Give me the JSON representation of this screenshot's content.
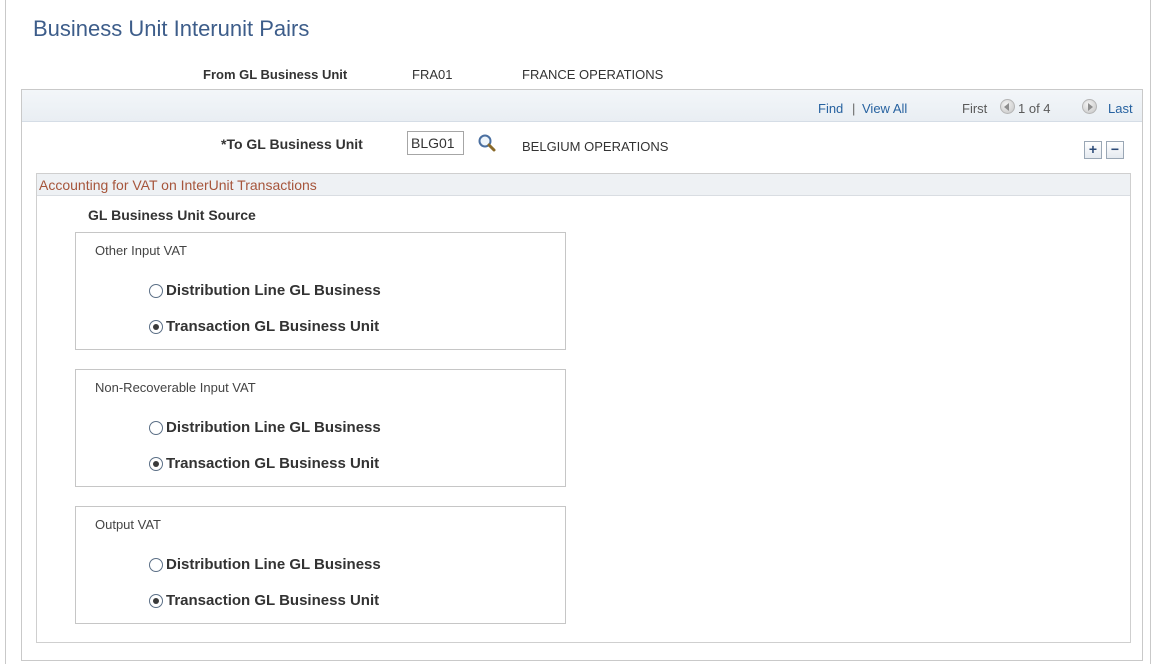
{
  "page": {
    "title": "Business Unit Interunit Pairs"
  },
  "from_unit": {
    "label": "From GL Business Unit",
    "value": "FRA01",
    "description": "FRANCE OPERATIONS"
  },
  "navigation": {
    "find": "Find",
    "separator": "|",
    "view_all": "View All",
    "first": "First",
    "count": "1 of 4",
    "last": "Last"
  },
  "to_unit": {
    "label": "*To GL Business Unit",
    "value": "BLG01",
    "description": "BELGIUM OPERATIONS"
  },
  "row_actions": {
    "add": "+",
    "delete": "−"
  },
  "vat_section": {
    "header": "Accounting for VAT on InterUnit Transactions",
    "source_label": "GL Business Unit Source",
    "groups": [
      {
        "title": "Other Input VAT",
        "options": [
          {
            "label": "Distribution Line GL Business",
            "selected": false
          },
          {
            "label": "Transaction GL Business Unit",
            "selected": true
          }
        ]
      },
      {
        "title": "Non-Recoverable Input VAT",
        "options": [
          {
            "label": "Distribution Line GL Business",
            "selected": false
          },
          {
            "label": "Transaction GL Business Unit",
            "selected": true
          }
        ]
      },
      {
        "title": "Output VAT",
        "options": [
          {
            "label": "Distribution Line GL Business",
            "selected": false
          },
          {
            "label": "Transaction GL Business Unit",
            "selected": true
          }
        ]
      }
    ]
  },
  "icons": {
    "lookup": "magnifier-icon",
    "previous": "previous-arrow-icon",
    "next": "next-arrow-icon",
    "add": "add-row-icon",
    "delete": "delete-row-icon"
  },
  "colors": {
    "title": "#3d5d8a",
    "link": "#2762a0",
    "section_header_text": "#a6553b"
  }
}
